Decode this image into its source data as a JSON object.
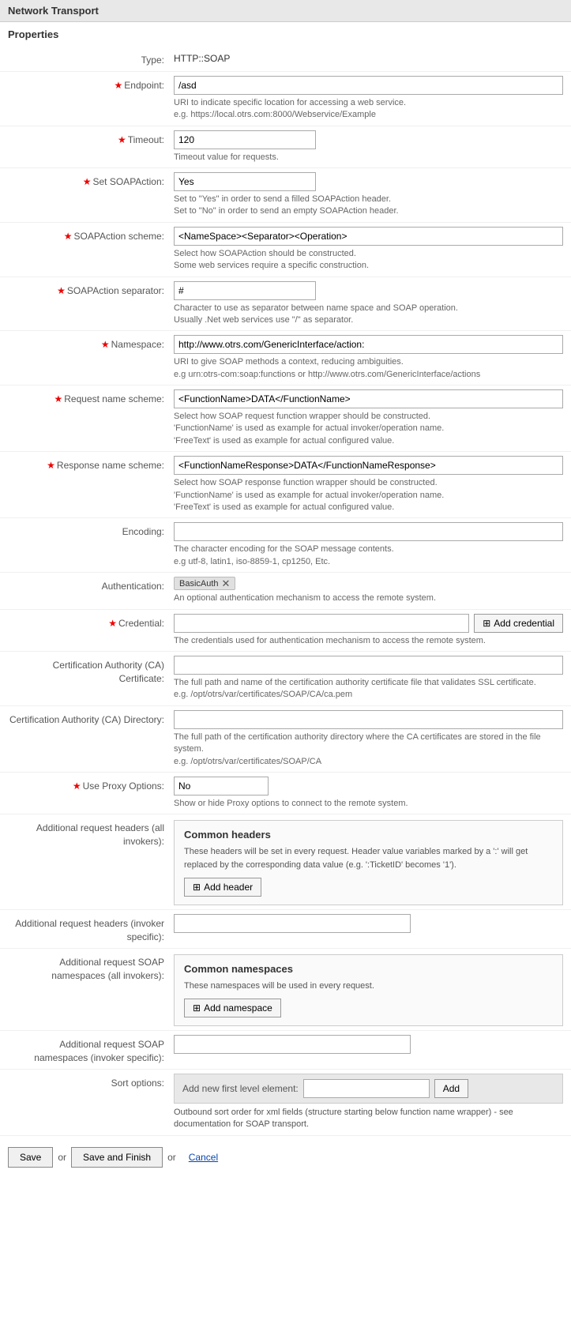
{
  "pageHeader": "Network Transport",
  "sectionHeader": "Properties",
  "fields": {
    "type": {
      "label": "Type:",
      "value": "HTTP::SOAP"
    },
    "endpoint": {
      "label": "Endpoint:",
      "required": true,
      "value": "/asd",
      "help1": "URI to indicate specific location for accessing a web service.",
      "help2": "e.g. https://local.otrs.com:8000/Webservice/Example"
    },
    "timeout": {
      "label": "Timeout:",
      "required": true,
      "value": "120",
      "help": "Timeout value for requests."
    },
    "setSOAPAction": {
      "label": "Set SOAPAction:",
      "required": true,
      "value": "Yes",
      "help1": "Set to \"Yes\" in order to send a filled SOAPAction header.",
      "help2": "Set to \"No\" in order to send an empty SOAPAction header."
    },
    "soapActionScheme": {
      "label": "SOAPAction scheme:",
      "required": true,
      "value": "<NameSpace><Separator><Operation>",
      "help1": "Select how SOAPAction should be constructed.",
      "help2": "Some web services require a specific construction."
    },
    "soapActionSeparator": {
      "label": "SOAPAction separator:",
      "required": true,
      "value": "#",
      "help1": "Character to use as separator between name space and SOAP operation.",
      "help2": "Usually .Net web services use \"/\" as separator."
    },
    "namespace": {
      "label": "Namespace:",
      "required": true,
      "value": "http://www.otrs.com/GenericInterface/action:",
      "help1": "URI to give SOAP methods a context, reducing ambiguities.",
      "help2": "e.g urn:otrs-com:soap:functions or http://www.otrs.com/GenericInterface/actions"
    },
    "requestNameScheme": {
      "label": "Request name scheme:",
      "required": true,
      "value": "<FunctionName>DATA</FunctionName>",
      "help1": "Select how SOAP request function wrapper should be constructed.",
      "help2": "'FunctionName' is used as example for actual invoker/operation name.",
      "help3": "'FreeText' is used as example for actual configured value."
    },
    "responseNameScheme": {
      "label": "Response name scheme:",
      "required": true,
      "value": "<FunctionNameResponse>DATA</FunctionNameResponse>",
      "help1": "Select how SOAP response function wrapper should be constructed.",
      "help2": "'FunctionName' is used as example for actual invoker/operation name.",
      "help3": "'FreeText' is used as example for actual configured value."
    },
    "encoding": {
      "label": "Encoding:",
      "value": "",
      "help1": "The character encoding for the SOAP message contents.",
      "help2": "e.g utf-8, latin1, iso-8859-1, cp1250, Etc."
    },
    "authentication": {
      "label": "Authentication:",
      "value": "BasicAuth",
      "help": "An optional authentication mechanism to access the remote system."
    },
    "credential": {
      "label": "Credential:",
      "required": true,
      "value": "",
      "addButton": "Add credential",
      "help": "The credentials used for authentication mechanism to access the remote system."
    },
    "caCertificate": {
      "label": "Certification Authority (CA) Certificate:",
      "value": "",
      "help1": "The full path and name of the certification authority certificate file that validates SSL certificate.",
      "help2": "e.g. /opt/otrs/var/certificates/SOAP/CA/ca.pem"
    },
    "caDirectory": {
      "label": "Certification Authority (CA) Directory:",
      "value": "",
      "help1": "The full path of the certification authority directory where the CA certificates are stored in the file system.",
      "help2": "e.g. /opt/otrs/var/certificates/SOAP/CA"
    },
    "useProxyOptions": {
      "label": "Use Proxy Options:",
      "required": true,
      "value": "No",
      "help": "Show or hide Proxy options to connect to the remote system."
    },
    "additionalRequestHeadersAll": {
      "label": "Additional request headers (all invokers):",
      "commonBox": {
        "title": "Common headers",
        "help": "These headers will be set in every request. Header value variables marked by a ':' will get replaced by the corresponding data value (e.g. ':TicketID' becomes '1').",
        "addButton": "Add header"
      }
    },
    "additionalRequestHeadersInvoker": {
      "label": "Additional request headers (invoker specific):",
      "value": ""
    },
    "additionalSOAPNamespacesAll": {
      "label": "Additional request SOAP namespaces (all invokers):",
      "commonBox": {
        "title": "Common namespaces",
        "help": "These namespaces will be used in every request.",
        "addButton": "Add namespace"
      }
    },
    "additionalSOAPNamespacesInvoker": {
      "label": "Additional request SOAP namespaces (invoker specific):",
      "value": ""
    },
    "sortOptions": {
      "label": "Sort options:",
      "newFirstLevelLabel": "Add new first level element:",
      "addButton": "Add",
      "outboundHelp1": "Outbound sort order for xml fields (structure starting below function name wrapper) - see",
      "outboundHelp2": "documentation for SOAP transport."
    }
  },
  "footer": {
    "saveLabel": "Save",
    "orLabel1": "or",
    "saveAndFinishLabel": "Save and Finish",
    "orLabel2": "or",
    "cancelLabel": "Cancel"
  }
}
